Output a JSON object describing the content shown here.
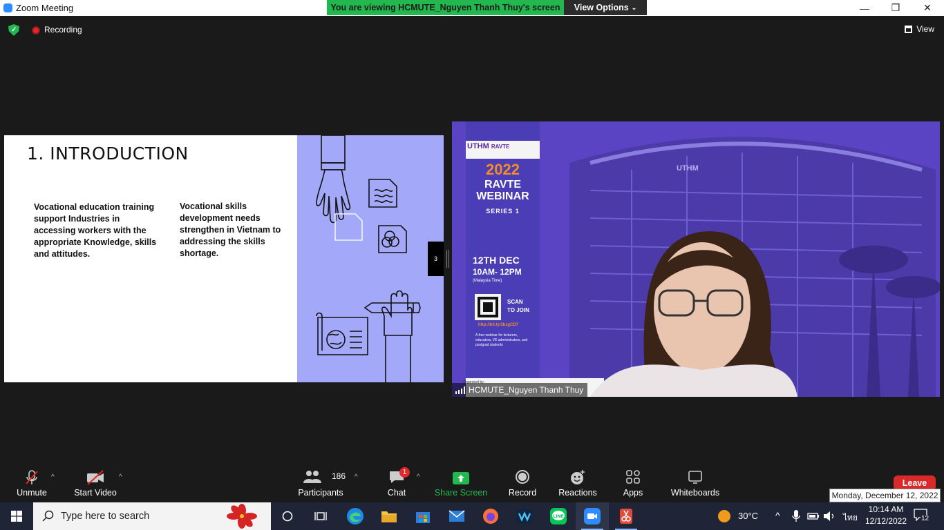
{
  "window": {
    "title": "Zoom Meeting",
    "viewing_banner": "You are viewing HCMUTE_Nguyen Thanh Thuy's screen",
    "view_options": "View Options",
    "minimize": "—",
    "restore": "❐",
    "close": "✕"
  },
  "meeting_bar": {
    "recording_label": "Recording",
    "view_label": "View"
  },
  "slide": {
    "title": "1. INTRODUCTION",
    "text_left": "Vocational education training support Industries in accessing workers with the appropriate Knowledge, skills and attitudes.",
    "text_right": "Vocational skills development needs strengthen in Vietnam to addressing the skills shortage.",
    "page_number": "3"
  },
  "video": {
    "participant_name": "HCMUTE_Nguyen Thanh Thuy",
    "poster": {
      "logo_left": "UTHM",
      "logo_right": "RAVTE",
      "year": "2022",
      "line1": "RAVTE",
      "line2": "WEBINAR",
      "series": "SERIES 1",
      "date": "12TH DEC",
      "time": "10AM- 12PM",
      "timezone": "(Malaysia Time)",
      "scan": "SCAN",
      "to_join": "TO JOIN",
      "link": "http://bit.ly/3bzgCD7",
      "desc": "A free webinar for lecturers, educators, VE administrators, and postgrad students",
      "organized_by": "Organised by:"
    },
    "building_sign": "UTHM"
  },
  "toolbar": {
    "unmute": "Unmute",
    "start_video": "Start Video",
    "participants": "Participants",
    "participant_count": "186",
    "chat": "Chat",
    "chat_badge": "1",
    "share_screen": "Share Screen",
    "record": "Record",
    "reactions": "Reactions",
    "apps": "Apps",
    "whiteboards": "Whiteboards",
    "leave": "Leave",
    "date_tooltip": "Monday, December 12, 2022"
  },
  "taskbar": {
    "search_placeholder": "Type here to search",
    "weather": "30°C",
    "language": "ไทย",
    "time": "10:14 AM",
    "date": "12/12/2022",
    "notification_count": "12"
  },
  "colors": {
    "share_green": "#23b84f",
    "leave_red": "#d9292a",
    "slide_panel": "#a3a8f8",
    "poster_purple": "#5a46c8"
  }
}
